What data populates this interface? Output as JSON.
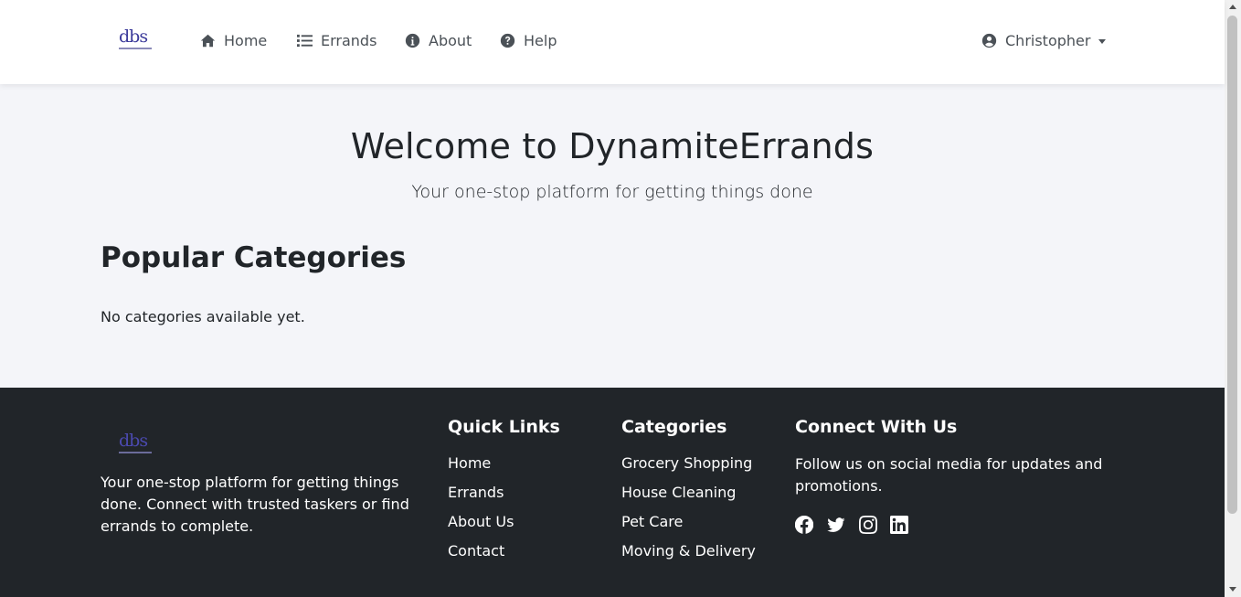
{
  "nav": {
    "logo_text": "dbs",
    "items": [
      {
        "label": "Home",
        "icon": "home-icon"
      },
      {
        "label": "Errands",
        "icon": "list-icon"
      },
      {
        "label": "About",
        "icon": "info-circle-icon"
      },
      {
        "label": "Help",
        "icon": "question-circle-icon"
      }
    ],
    "user": {
      "name": "Christopher",
      "icon": "user-circle-icon"
    }
  },
  "hero": {
    "title": "Welcome to DynamiteErrands",
    "subtitle": "Your one-stop platform for getting things done"
  },
  "categories_section": {
    "title": "Popular Categories",
    "empty_text": "No categories available yet."
  },
  "footer": {
    "logo_text": "dbs",
    "description": "Your one-stop platform for getting things done. Connect with trusted taskers or find errands to complete.",
    "quick_links": {
      "title": "Quick Links",
      "items": [
        "Home",
        "Errands",
        "About Us",
        "Contact"
      ]
    },
    "categories": {
      "title": "Categories",
      "items": [
        "Grocery Shopping",
        "House Cleaning",
        "Pet Care",
        "Moving & Delivery"
      ]
    },
    "connect": {
      "title": "Connect With Us",
      "text": "Follow us on social media for updates and promotions.",
      "socials": [
        "facebook-icon",
        "twitter-icon",
        "instagram-icon",
        "linkedin-icon"
      ]
    }
  },
  "colors": {
    "navbar_bg": "#ffffff",
    "page_bg": "#f4f5f9",
    "footer_bg": "#212529",
    "text_dark": "#212529",
    "nav_text": "#4b5157",
    "logo_blue": "#3b3a9a"
  }
}
